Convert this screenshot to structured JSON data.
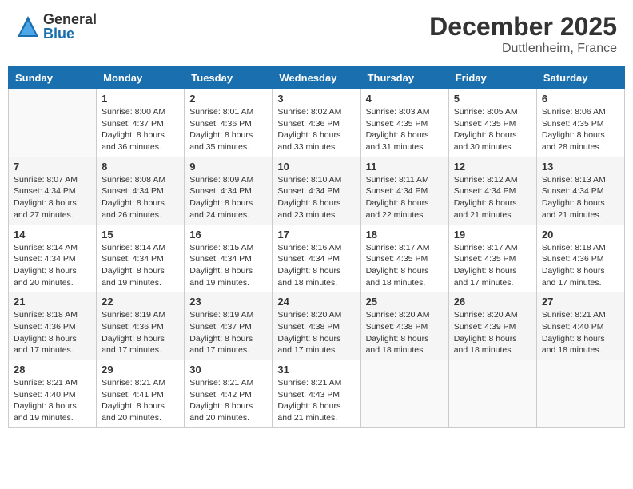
{
  "header": {
    "logo": {
      "general": "General",
      "blue": "Blue"
    },
    "title": "December 2025",
    "location": "Duttlenheim, France"
  },
  "days_of_week": [
    "Sunday",
    "Monday",
    "Tuesday",
    "Wednesday",
    "Thursday",
    "Friday",
    "Saturday"
  ],
  "weeks": [
    [
      {
        "day": "",
        "empty": true
      },
      {
        "day": "1",
        "sunrise": "Sunrise: 8:00 AM",
        "sunset": "Sunset: 4:37 PM",
        "daylight": "Daylight: 8 hours and 36 minutes."
      },
      {
        "day": "2",
        "sunrise": "Sunrise: 8:01 AM",
        "sunset": "Sunset: 4:36 PM",
        "daylight": "Daylight: 8 hours and 35 minutes."
      },
      {
        "day": "3",
        "sunrise": "Sunrise: 8:02 AM",
        "sunset": "Sunset: 4:36 PM",
        "daylight": "Daylight: 8 hours and 33 minutes."
      },
      {
        "day": "4",
        "sunrise": "Sunrise: 8:03 AM",
        "sunset": "Sunset: 4:35 PM",
        "daylight": "Daylight: 8 hours and 31 minutes."
      },
      {
        "day": "5",
        "sunrise": "Sunrise: 8:05 AM",
        "sunset": "Sunset: 4:35 PM",
        "daylight": "Daylight: 8 hours and 30 minutes."
      },
      {
        "day": "6",
        "sunrise": "Sunrise: 8:06 AM",
        "sunset": "Sunset: 4:35 PM",
        "daylight": "Daylight: 8 hours and 28 minutes."
      }
    ],
    [
      {
        "day": "7",
        "sunrise": "Sunrise: 8:07 AM",
        "sunset": "Sunset: 4:34 PM",
        "daylight": "Daylight: 8 hours and 27 minutes."
      },
      {
        "day": "8",
        "sunrise": "Sunrise: 8:08 AM",
        "sunset": "Sunset: 4:34 PM",
        "daylight": "Daylight: 8 hours and 26 minutes."
      },
      {
        "day": "9",
        "sunrise": "Sunrise: 8:09 AM",
        "sunset": "Sunset: 4:34 PM",
        "daylight": "Daylight: 8 hours and 24 minutes."
      },
      {
        "day": "10",
        "sunrise": "Sunrise: 8:10 AM",
        "sunset": "Sunset: 4:34 PM",
        "daylight": "Daylight: 8 hours and 23 minutes."
      },
      {
        "day": "11",
        "sunrise": "Sunrise: 8:11 AM",
        "sunset": "Sunset: 4:34 PM",
        "daylight": "Daylight: 8 hours and 22 minutes."
      },
      {
        "day": "12",
        "sunrise": "Sunrise: 8:12 AM",
        "sunset": "Sunset: 4:34 PM",
        "daylight": "Daylight: 8 hours and 21 minutes."
      },
      {
        "day": "13",
        "sunrise": "Sunrise: 8:13 AM",
        "sunset": "Sunset: 4:34 PM",
        "daylight": "Daylight: 8 hours and 21 minutes."
      }
    ],
    [
      {
        "day": "14",
        "sunrise": "Sunrise: 8:14 AM",
        "sunset": "Sunset: 4:34 PM",
        "daylight": "Daylight: 8 hours and 20 minutes."
      },
      {
        "day": "15",
        "sunrise": "Sunrise: 8:14 AM",
        "sunset": "Sunset: 4:34 PM",
        "daylight": "Daylight: 8 hours and 19 minutes."
      },
      {
        "day": "16",
        "sunrise": "Sunrise: 8:15 AM",
        "sunset": "Sunset: 4:34 PM",
        "daylight": "Daylight: 8 hours and 19 minutes."
      },
      {
        "day": "17",
        "sunrise": "Sunrise: 8:16 AM",
        "sunset": "Sunset: 4:34 PM",
        "daylight": "Daylight: 8 hours and 18 minutes."
      },
      {
        "day": "18",
        "sunrise": "Sunrise: 8:17 AM",
        "sunset": "Sunset: 4:35 PM",
        "daylight": "Daylight: 8 hours and 18 minutes."
      },
      {
        "day": "19",
        "sunrise": "Sunrise: 8:17 AM",
        "sunset": "Sunset: 4:35 PM",
        "daylight": "Daylight: 8 hours and 17 minutes."
      },
      {
        "day": "20",
        "sunrise": "Sunrise: 8:18 AM",
        "sunset": "Sunset: 4:36 PM",
        "daylight": "Daylight: 8 hours and 17 minutes."
      }
    ],
    [
      {
        "day": "21",
        "sunrise": "Sunrise: 8:18 AM",
        "sunset": "Sunset: 4:36 PM",
        "daylight": "Daylight: 8 hours and 17 minutes."
      },
      {
        "day": "22",
        "sunrise": "Sunrise: 8:19 AM",
        "sunset": "Sunset: 4:36 PM",
        "daylight": "Daylight: 8 hours and 17 minutes."
      },
      {
        "day": "23",
        "sunrise": "Sunrise: 8:19 AM",
        "sunset": "Sunset: 4:37 PM",
        "daylight": "Daylight: 8 hours and 17 minutes."
      },
      {
        "day": "24",
        "sunrise": "Sunrise: 8:20 AM",
        "sunset": "Sunset: 4:38 PM",
        "daylight": "Daylight: 8 hours and 17 minutes."
      },
      {
        "day": "25",
        "sunrise": "Sunrise: 8:20 AM",
        "sunset": "Sunset: 4:38 PM",
        "daylight": "Daylight: 8 hours and 18 minutes."
      },
      {
        "day": "26",
        "sunrise": "Sunrise: 8:20 AM",
        "sunset": "Sunset: 4:39 PM",
        "daylight": "Daylight: 8 hours and 18 minutes."
      },
      {
        "day": "27",
        "sunrise": "Sunrise: 8:21 AM",
        "sunset": "Sunset: 4:40 PM",
        "daylight": "Daylight: 8 hours and 18 minutes."
      }
    ],
    [
      {
        "day": "28",
        "sunrise": "Sunrise: 8:21 AM",
        "sunset": "Sunset: 4:40 PM",
        "daylight": "Daylight: 8 hours and 19 minutes."
      },
      {
        "day": "29",
        "sunrise": "Sunrise: 8:21 AM",
        "sunset": "Sunset: 4:41 PM",
        "daylight": "Daylight: 8 hours and 20 minutes."
      },
      {
        "day": "30",
        "sunrise": "Sunrise: 8:21 AM",
        "sunset": "Sunset: 4:42 PM",
        "daylight": "Daylight: 8 hours and 20 minutes."
      },
      {
        "day": "31",
        "sunrise": "Sunrise: 8:21 AM",
        "sunset": "Sunset: 4:43 PM",
        "daylight": "Daylight: 8 hours and 21 minutes."
      },
      {
        "day": "",
        "empty": true
      },
      {
        "day": "",
        "empty": true
      },
      {
        "day": "",
        "empty": true
      }
    ]
  ]
}
